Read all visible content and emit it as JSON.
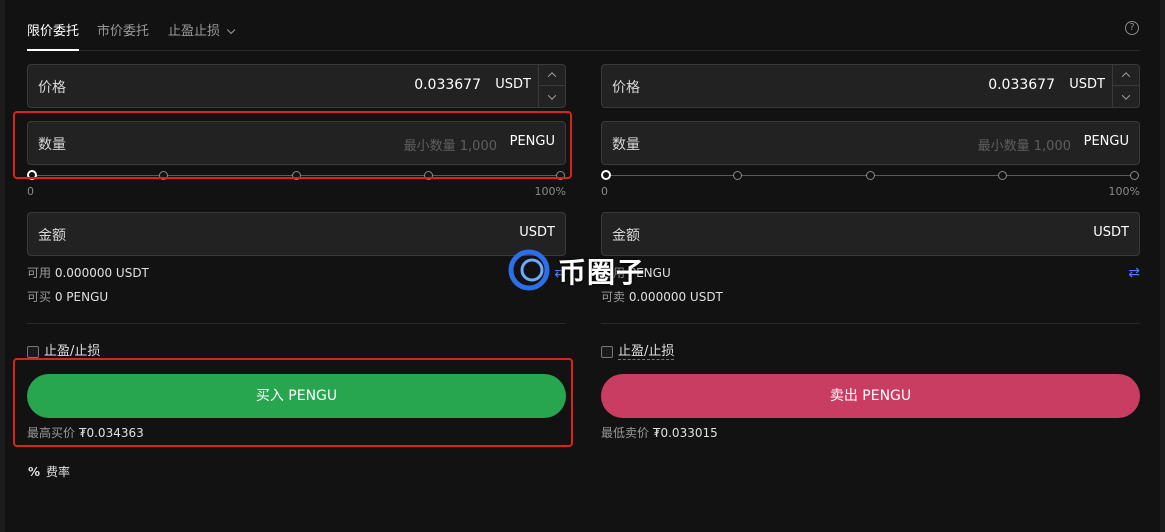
{
  "tabs": {
    "items": [
      "限价委托",
      "市价委托",
      "止盈止损"
    ],
    "help": "?"
  },
  "buy": {
    "price_label": "价格",
    "price_value": "0.033677",
    "price_unit": "USDT",
    "qty_label": "数量",
    "qty_placeholder": "最小数量 1,000",
    "qty_unit": "PENGU",
    "slider_min": "0",
    "slider_max": "100%",
    "slider_level": 0,
    "amount_label": "金额",
    "amount_unit": "USDT",
    "available_label": "可用",
    "available_value": "0.000000 USDT",
    "can_trade_label": "可买",
    "can_trade_value": "0 PENGU",
    "tpsl_label": "止盈/止损",
    "button": "买入 PENGU",
    "best_label": "最高买价",
    "best_value": "₮0.034363"
  },
  "sell": {
    "price_label": "价格",
    "price_value": "0.033677",
    "price_unit": "USDT",
    "qty_label": "数量",
    "qty_placeholder": "最小数量 1,000",
    "qty_unit": "PENGU",
    "slider_min": "0",
    "slider_max": "100%",
    "slider_level": 0,
    "amount_label": "金额",
    "amount_unit": "USDT",
    "available_label": "可用",
    "available_value": "PENGU",
    "can_trade_label": "可卖",
    "can_trade_value": "0.000000 USDT",
    "tpsl_label": "止盈/止损",
    "button": "卖出 PENGU",
    "best_label": "最低卖价",
    "best_value": "₮0.033015"
  },
  "fee": {
    "icon": "%",
    "label": "费率"
  },
  "watermark": "币圈子",
  "colors": {
    "buy": "#27a64f",
    "sell": "#c93d62",
    "highlight": "#d8241a",
    "swap": "#4b7bff"
  }
}
